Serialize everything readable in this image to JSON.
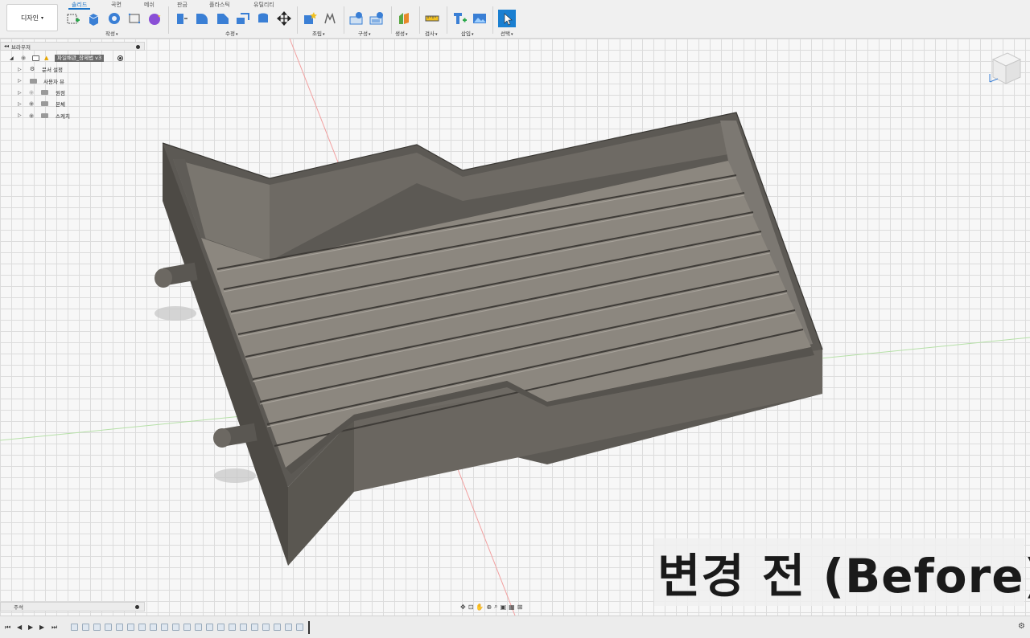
{
  "toolbar": {
    "design_button": "디자인",
    "tabs": [
      "솔리드",
      "곡면",
      "메쉬",
      "판금",
      "플라스틱",
      "유틸리티"
    ],
    "active_tab": "솔리드",
    "groups": [
      "작성",
      "수정",
      "조립",
      "구성",
      "생성",
      "검사",
      "삽입",
      "선택"
    ]
  },
  "browser": {
    "title": "브라우저",
    "root": "파일배관_장제법 v3",
    "items": [
      {
        "label": "문서 설정",
        "icon": "gear-icon"
      },
      {
        "label": "사용자 뷰",
        "icon": "folder-icon"
      },
      {
        "label": "원점",
        "icon": "folder-icon"
      },
      {
        "label": "본체",
        "icon": "folder-icon"
      },
      {
        "label": "스케치",
        "icon": "folder-icon"
      }
    ]
  },
  "comments": {
    "label": "주석"
  },
  "overlay": {
    "before_text": "변경 전 (Before)"
  },
  "colors": {
    "accent": "#1a73c7",
    "body": "#6e6a64",
    "body_dark": "#4d4a45",
    "floor": "#8c877f"
  }
}
